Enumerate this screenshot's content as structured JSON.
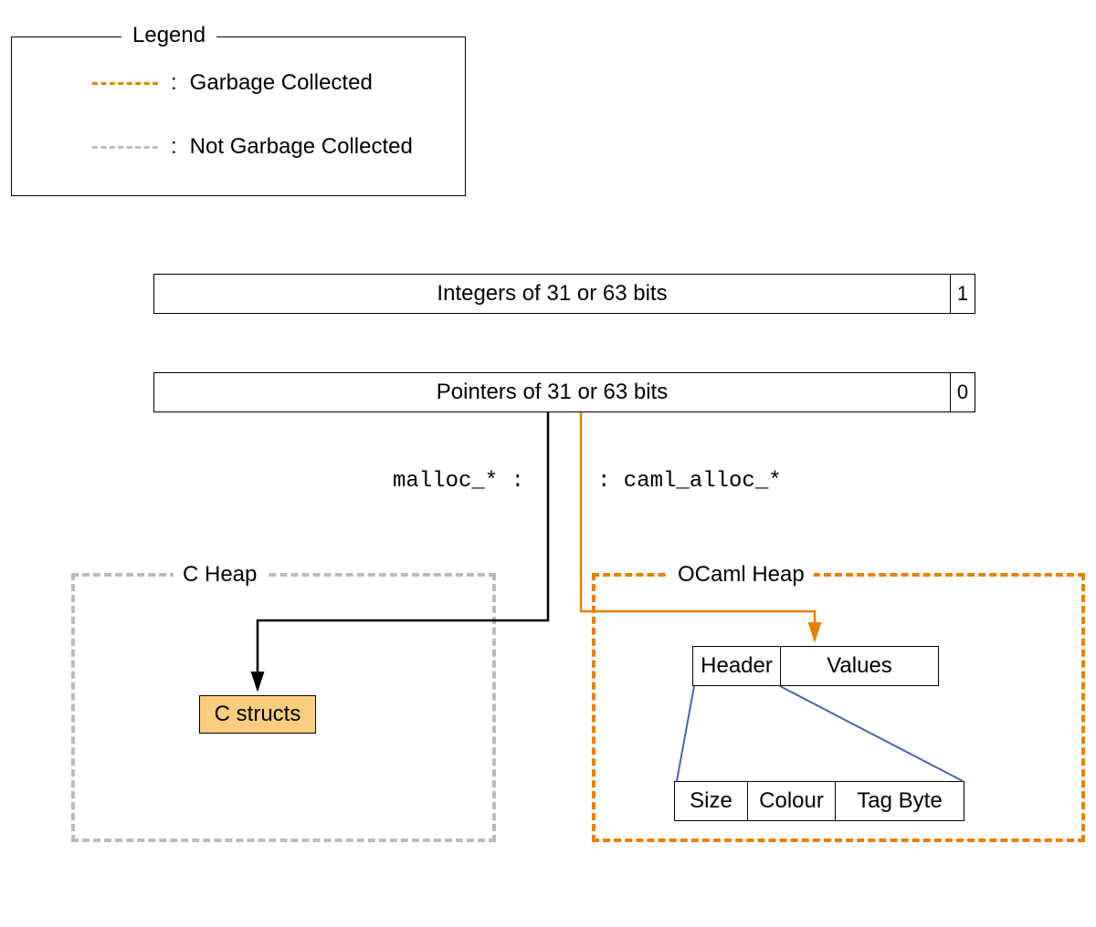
{
  "legend": {
    "title": "Legend",
    "gc_label": "Garbage Collected",
    "not_gc_label": "Not Garbage Collected",
    "colon": ":",
    "gc_color": "#e78200",
    "not_gc_color": "#bababa"
  },
  "integer_box": {
    "label": "Integers of 31 or 63 bits",
    "tag": "1"
  },
  "pointer_box": {
    "label": "Pointers of 31 or 63 bits",
    "tag": "0"
  },
  "alloc": {
    "malloc": "malloc_* :",
    "caml": ": caml_alloc_*"
  },
  "c_heap": {
    "title": "C Heap",
    "structs": "C structs"
  },
  "ocaml_heap": {
    "title": "OCaml Heap",
    "block": {
      "header": "Header",
      "values": "Values"
    },
    "header_fields": {
      "size": "Size",
      "colour": "Colour",
      "tag_byte": "Tag Byte"
    }
  }
}
